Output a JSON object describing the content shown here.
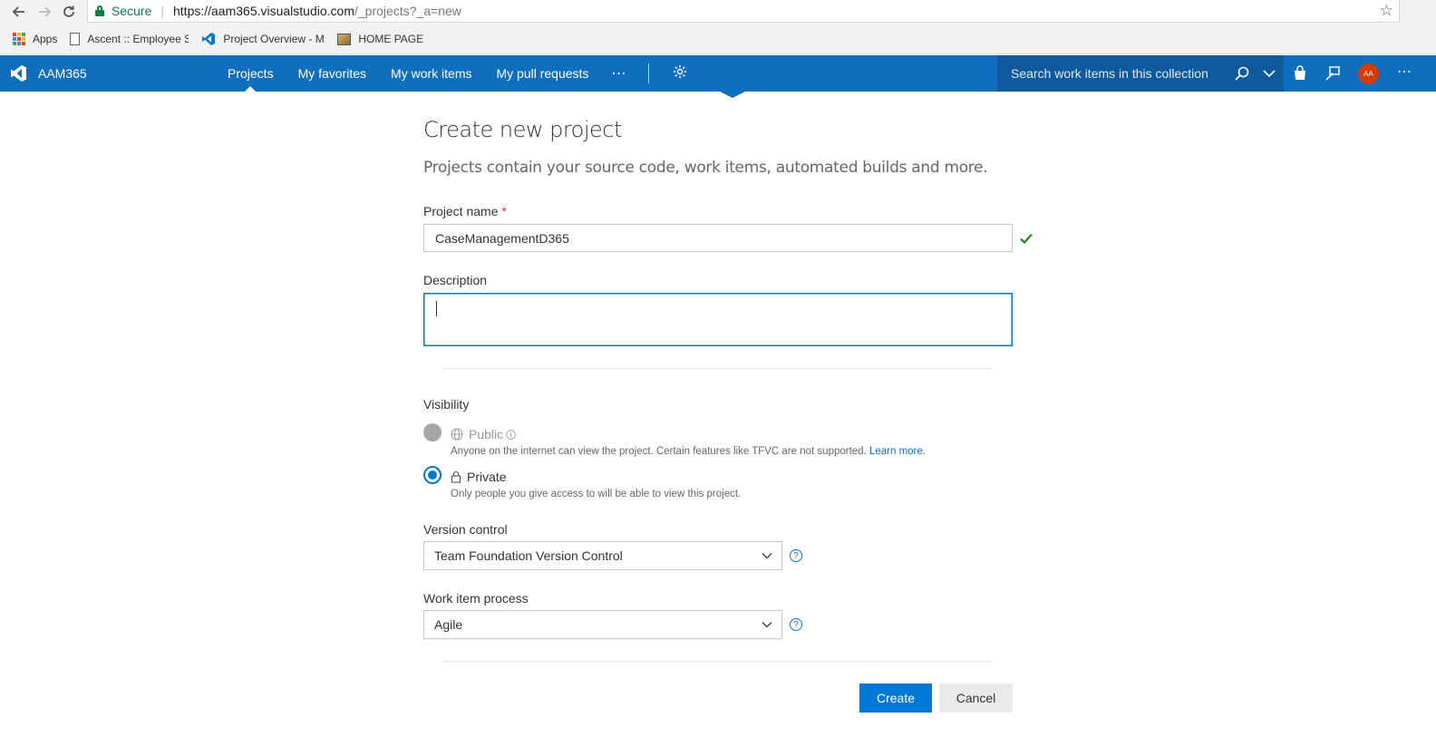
{
  "browser": {
    "secure_label": "Secure",
    "url_host": "https://aam365.visualstudio.com",
    "url_path": "/_projects?_a=new",
    "bookmarks": [
      {
        "label": "Apps"
      },
      {
        "label": "Ascent :: Employee Se"
      },
      {
        "label": "Project Overview - Mi"
      },
      {
        "label": "HOME PAGE"
      }
    ]
  },
  "header": {
    "org_name": "AAM365",
    "hubs": [
      {
        "label": "Projects",
        "active": true
      },
      {
        "label": "My favorites"
      },
      {
        "label": "My work items"
      },
      {
        "label": "My pull requests"
      }
    ],
    "more": "⋯",
    "search_placeholder": "Search work items in this collection",
    "avatar_initials": "AA",
    "brand_color": "#106ebe"
  },
  "form": {
    "title": "Create new project",
    "subtitle": "Projects contain your source code, work items, automated builds and more.",
    "project_name_label": "Project name",
    "required_mark": "*",
    "project_name_value": "CaseManagementD365",
    "description_label": "Description",
    "description_value": "",
    "visibility_label": "Visibility",
    "visibility_options": [
      {
        "label": "Public",
        "description": "Anyone on the internet can view the project. Certain features like TFVC are not supported.",
        "link": "Learn more.",
        "state": "disabled"
      },
      {
        "label": "Private",
        "description": "Only people you give access to will be able to view this project.",
        "state": "checked"
      }
    ],
    "version_control_label": "Version control",
    "version_control_value": "Team Foundation Version Control",
    "work_item_process_label": "Work item process",
    "work_item_process_value": "Agile",
    "help_glyph": "?",
    "create_label": "Create",
    "cancel_label": "Cancel"
  }
}
